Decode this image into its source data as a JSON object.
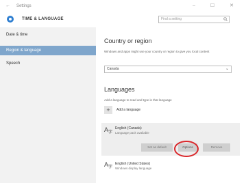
{
  "titlebar": {
    "back": "←",
    "title": "Settings",
    "controls": "– ☐ ✕"
  },
  "header": {
    "title": "TIME & LANGUAGE",
    "search_placeholder": "Find a setting"
  },
  "sidebar": {
    "items": [
      {
        "label": "Date & time"
      },
      {
        "label": "Region & language"
      },
      {
        "label": "Speech"
      }
    ]
  },
  "region": {
    "heading": "Country or region",
    "description": "Windows and apps might use your country or region to give you local content",
    "selected": "Canada"
  },
  "languages": {
    "heading": "Languages",
    "description": "Add a language to read and type in that language",
    "add_label": "Add a language",
    "items": [
      {
        "name": "English (Canada)",
        "sub": "Language pack available"
      },
      {
        "name": "English (United States)",
        "sub": "Windows display language"
      }
    ],
    "buttons": {
      "default": "Set as default",
      "options": "Options",
      "remove": "Remove"
    }
  },
  "colors": {
    "selected_nav": "#7fa6cc",
    "highlight": "#d9262a"
  }
}
